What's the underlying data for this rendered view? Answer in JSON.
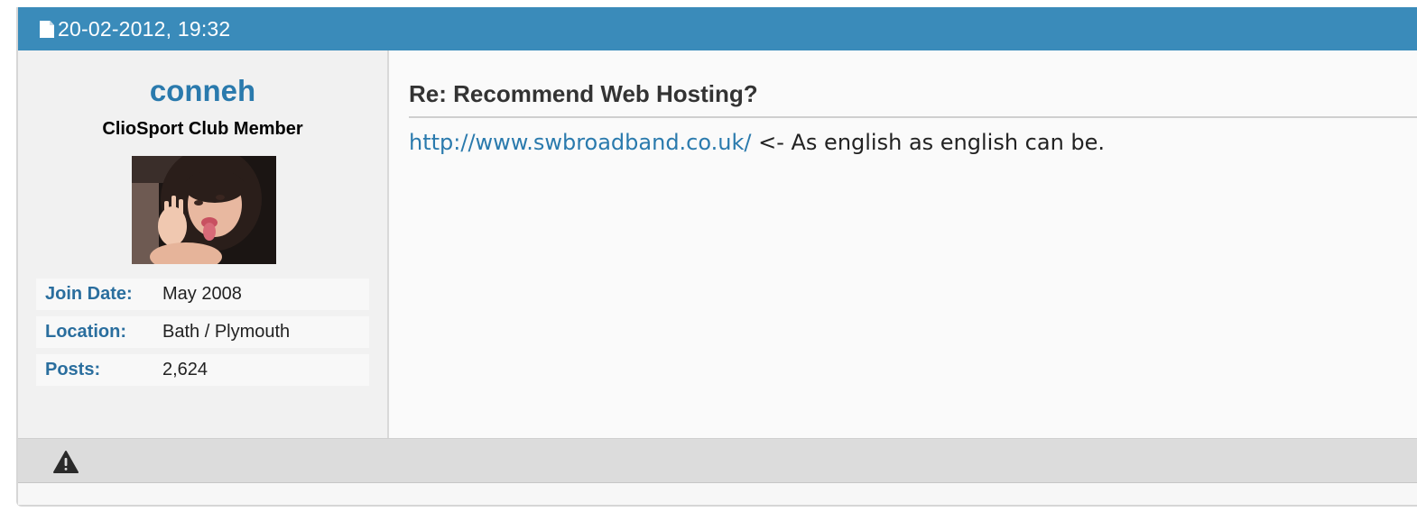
{
  "post": {
    "date": "20-02-2012, 19:32",
    "user": {
      "name": "conneh",
      "title": "ClioSport Club Member",
      "stats": [
        {
          "key": "Join Date:",
          "value": "May 2008"
        },
        {
          "key": "Location:",
          "value": "Bath / Plymouth"
        },
        {
          "key": "Posts:",
          "value": "2,624"
        }
      ]
    },
    "title": "Re: Recommend Web Hosting?",
    "content": {
      "link_text": "http://www.swbroadband.co.uk/",
      "text": " <- As english as english can be."
    }
  },
  "icons": {
    "date": "document-icon",
    "report": "warning-icon"
  },
  "colors": {
    "header": "#3a8bba",
    "link": "#2a7aad",
    "footer": "#dcdcdc"
  }
}
